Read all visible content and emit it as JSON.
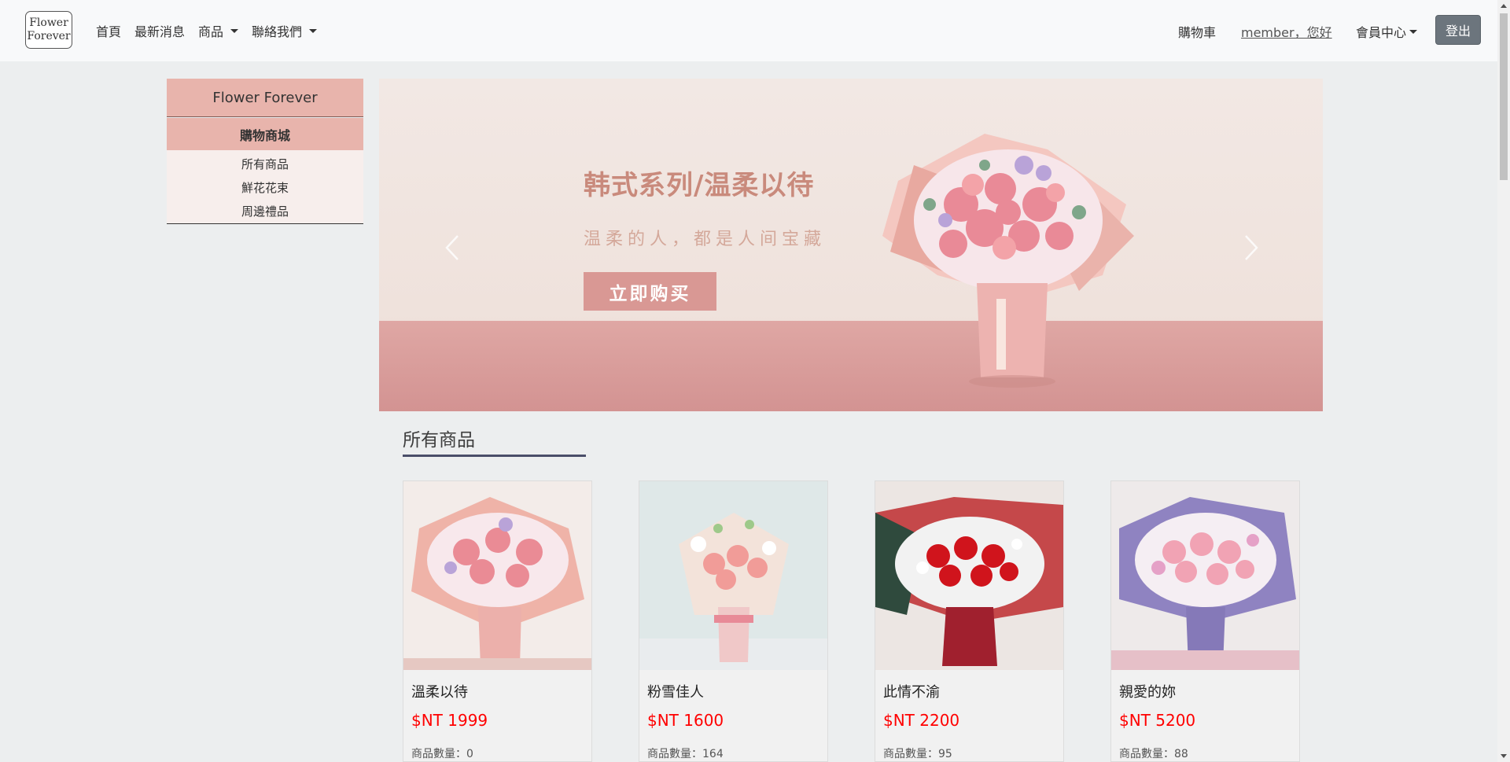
{
  "nav": {
    "logo_line1": "Flower",
    "logo_line2": "Forever",
    "home": "首頁",
    "news": "最新消息",
    "products": "商品",
    "contact": "聯絡我們",
    "cart": "購物車",
    "member_greeting": "member，您好",
    "member_center": "會員中心",
    "logout": "登出"
  },
  "sidebar": {
    "title": "Flower Forever",
    "section": "購物商城",
    "items": [
      {
        "label": "所有商品"
      },
      {
        "label": "鮮花花束"
      },
      {
        "label": "周邊禮品"
      }
    ]
  },
  "banner": {
    "headline": "韩式系列/温柔以待",
    "subheadline": "温柔的人，都是人间宝藏",
    "cta": "立即购买"
  },
  "section": {
    "title": "所有商品"
  },
  "products": [
    {
      "name": "溫柔以待",
      "price": "$NT 1999",
      "qty": "商品數量：0",
      "icon": "pink-bouquet"
    },
    {
      "name": "粉雪佳人",
      "price": "$NT 1600",
      "qty": "商品數量：164",
      "icon": "lily-bouquet"
    },
    {
      "name": "此情不渝",
      "price": "$NT 2200",
      "qty": "商品數量：95",
      "icon": "red-rose-bouquet"
    },
    {
      "name": "親愛的妳",
      "price": "$NT 5200",
      "qty": "商品數量：88",
      "icon": "purple-bouquet"
    }
  ],
  "colors": {
    "navbar_bg": "#f8f9fa",
    "page_bg": "#eceeef",
    "sidebar_accent": "#e8b4ac",
    "price_red": "#ff0000",
    "logout_btn": "#6c757d"
  }
}
